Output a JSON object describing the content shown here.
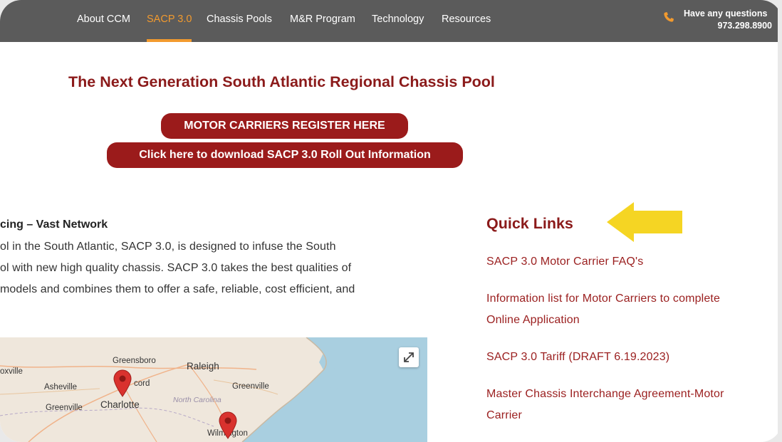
{
  "nav": {
    "items": [
      {
        "label": "About CCM",
        "active": false
      },
      {
        "label": "SACP 3.0",
        "active": true
      },
      {
        "label": "Chassis Pools",
        "active": false
      },
      {
        "label": "M&R Program",
        "active": false
      },
      {
        "label": "Technology",
        "active": false
      },
      {
        "label": "Resources",
        "active": false
      }
    ],
    "contact_question": "Have any questions",
    "contact_phone": "973.298.8900"
  },
  "hero": {
    "title": "The Next Generation South Atlantic Regional Chassis Pool",
    "register_button": "MOTOR CARRIERS REGISTER HERE",
    "download_button": "Click here to download SACP 3.0 Roll Out Information"
  },
  "intro": {
    "title": "cing – Vast Network",
    "lines": [
      "ol in the South Atlantic, SACP 3.0, is designed to infuse the South",
      "ol with new high quality chassis. SACP 3.0 takes the best qualities of",
      " models and combines them to offer a safe, reliable, cost efficient, and"
    ]
  },
  "map": {
    "labels": [
      "Greensboro",
      "Raleigh",
      "oxville",
      "Asheville",
      "cord",
      "Greenville",
      "Greenville",
      "Charlotte",
      "North Carolina",
      "Wilmington"
    ]
  },
  "quick_links": {
    "title": "Quick Links",
    "links": [
      {
        "lines": [
          "SACP 3.0 Motor Carrier FAQ's"
        ]
      },
      {
        "lines": [
          "Information list for Motor Carriers to complete",
          "Online Application"
        ]
      },
      {
        "lines": [
          "SACP 3.0 Tariff (DRAFT 6.19.2023)"
        ]
      },
      {
        "lines": [
          "Master Chassis Interchange Agreement-Motor",
          "Carrier"
        ]
      }
    ]
  },
  "colors": {
    "nav_bg": "#5b5b5b",
    "accent_orange": "#f29a2e",
    "brand_red": "#9b1b1b",
    "arrow_yellow": "#f5d523"
  },
  "icons": [
    "phone-icon",
    "expand-icon",
    "map-pin-icon",
    "arrow-left-icon"
  ]
}
